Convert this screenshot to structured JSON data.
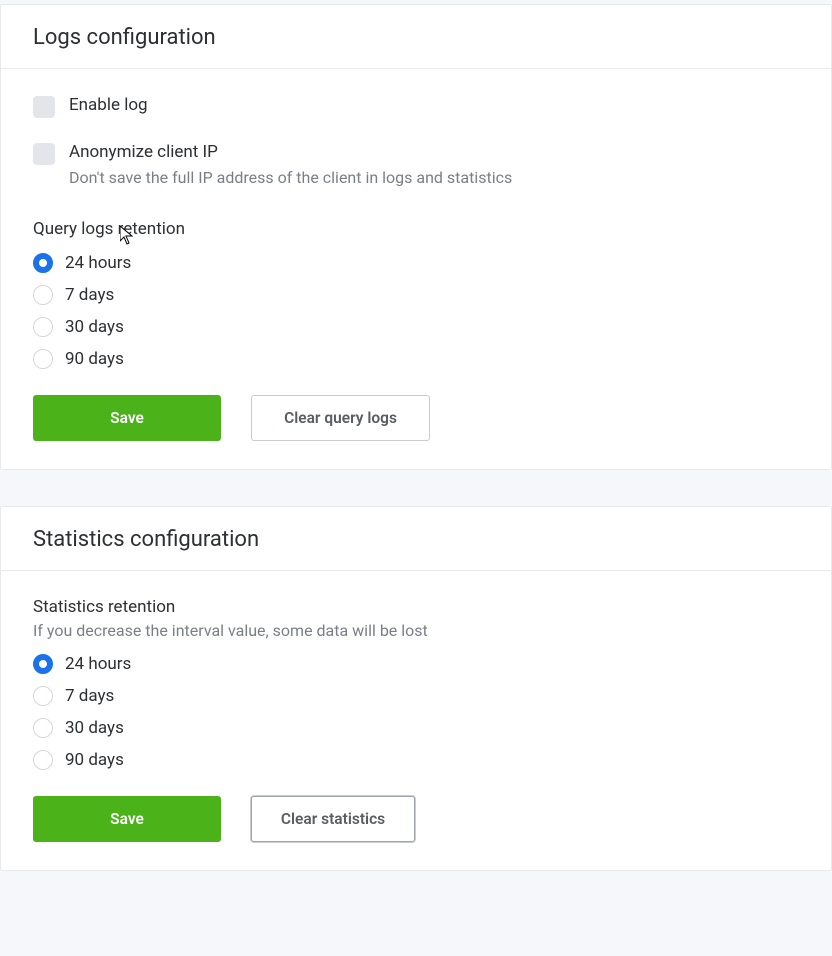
{
  "logs": {
    "title": "Logs configuration",
    "enable_log": {
      "label": "Enable log",
      "checked": false
    },
    "anonymize": {
      "label": "Anonymize client IP",
      "helper": "Don't save the full IP address of the client in logs and statistics",
      "checked": false
    },
    "retention": {
      "label": "Query logs retention",
      "selected_index": 0,
      "options": [
        "24 hours",
        "7 days",
        "30 days",
        "90 days"
      ]
    },
    "save_label": "Save",
    "clear_label": "Clear query logs"
  },
  "stats": {
    "title": "Statistics configuration",
    "retention": {
      "label": "Statistics retention",
      "helper": "If you decrease the interval value, some data will be lost",
      "selected_index": 0,
      "options": [
        "24 hours",
        "7 days",
        "30 days",
        "90 days"
      ]
    },
    "save_label": "Save",
    "clear_label": "Clear statistics"
  },
  "colors": {
    "primary_green": "#4bb21a",
    "radio_blue": "#1a73e8"
  }
}
